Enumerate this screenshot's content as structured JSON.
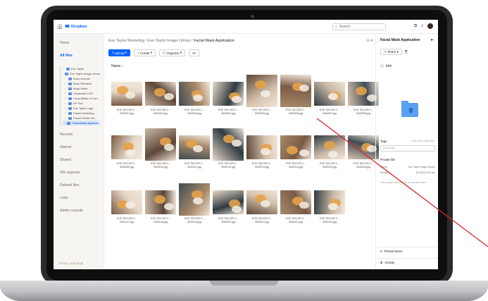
{
  "window": {
    "brand": "Dropbox"
  },
  "topbar": {
    "search_placeholder": "Search"
  },
  "breadcrumb": {
    "parts": [
      "Eve Taylor Marketing",
      "Eve Taylor Image Library"
    ],
    "current": "Facial Mask Application"
  },
  "toolbar": {
    "upload": "Upload",
    "create": "Create",
    "organize": "Organize",
    "more": "•••"
  },
  "sort_label": "Name",
  "sidebar": {
    "home": "Home",
    "all_files": "All files",
    "tree": [
      "Eric Taylor",
      "Eve Taylor Image Library",
      "Body Aromas",
      "Body Renewal",
      "Body Wash",
      "Christmas 2022",
      "Consultation & Con...",
      "EP Test",
      "Eve Taylor Logo",
      "Facial Cleansing",
      "Facial Gentle Exf...",
      "Facial Mask Applicat..."
    ],
    "nav": [
      "Recents",
      "Starred",
      "Shared",
      "File requests",
      "Deleted files",
      "Links",
      "Admin console"
    ],
    "bottom": "Privacy and legal"
  },
  "tiles": [
    {
      "name": "EVE TAYLOR 2...",
      "file": "0000001.jpg"
    },
    {
      "name": "EVE TAYLOR 2...",
      "file": "0000002.jpg"
    },
    {
      "name": "EVE TAYLOR 2...",
      "file": "0000003.jpg"
    },
    {
      "name": "EVE TAYLOR 2...",
      "file": "0000004.jpg"
    },
    {
      "name": "EVE TAYLOR 2...",
      "file": "0000005.jpg"
    },
    {
      "name": "EVE TAYLOR 2...",
      "file": "0000006.jpg"
    },
    {
      "name": "EVE TAYLOR 2...",
      "file": "0000007.jpg"
    },
    {
      "name": "EVE TAYLOR 2...",
      "file": "0000008.jpg"
    },
    {
      "name": "EVE TAYLOR 2...",
      "file": "0000009.jpg"
    },
    {
      "name": "EVE TAYLOR 2...",
      "file": "0000010.jpg"
    },
    {
      "name": "EVE TAYLOR 2...",
      "file": "0000011.jpg"
    },
    {
      "name": "EVE TAYLOR 2...",
      "file": "0000012.jpg"
    },
    {
      "name": "EVE TAYLOR 2...",
      "file": "0000013.jpg"
    },
    {
      "name": "EVE TAYLOR 2...",
      "file": "0000014.jpg"
    },
    {
      "name": "EVE TAYLOR 2...",
      "file": "0000015.jpg"
    },
    {
      "name": "EVE TAYLOR 2...",
      "file": "0000016.jpg"
    },
    {
      "name": "EVE TAYLOR 2...",
      "file": "0000017.jpg"
    },
    {
      "name": "EVE TAYLOR 2...",
      "file": "0000018.jpg"
    },
    {
      "name": "EVE TAYLOR 2...",
      "file": "0000019.jpg"
    },
    {
      "name": "EVE TAYLOR 2...",
      "file": "0000020.jpg"
    },
    {
      "name": "EVE TAYLOR 2...",
      "file": "0000021.jpg"
    },
    {
      "name": "EVE TAYLOR 2...",
      "file": "0000022.jpg"
    },
    {
      "name": "EVE TAYLOR 2...",
      "file": "0000023.jpg"
    }
  ],
  "panel": {
    "title": "Facial Mask Application",
    "share": "Share",
    "info": "Info",
    "tags": "Tags",
    "tags_hint": "Why can't I add tags?",
    "tag_placeholder": "Add a tag",
    "privacy": "Private file",
    "rows": [
      {
        "k": "Owner",
        "v": "Eve Taylor Image Library"
      },
      {
        "k": "Modified",
        "v": "6/7/2023 8:09 am"
      }
    ],
    "link": "Only people with access can see this folder",
    "pinned": "Pinned items",
    "activity": "Activity"
  },
  "colors": {
    "accent": "#0061fe",
    "selected_bg": "#d8e6ff",
    "annotation_line": "#d9262c"
  }
}
